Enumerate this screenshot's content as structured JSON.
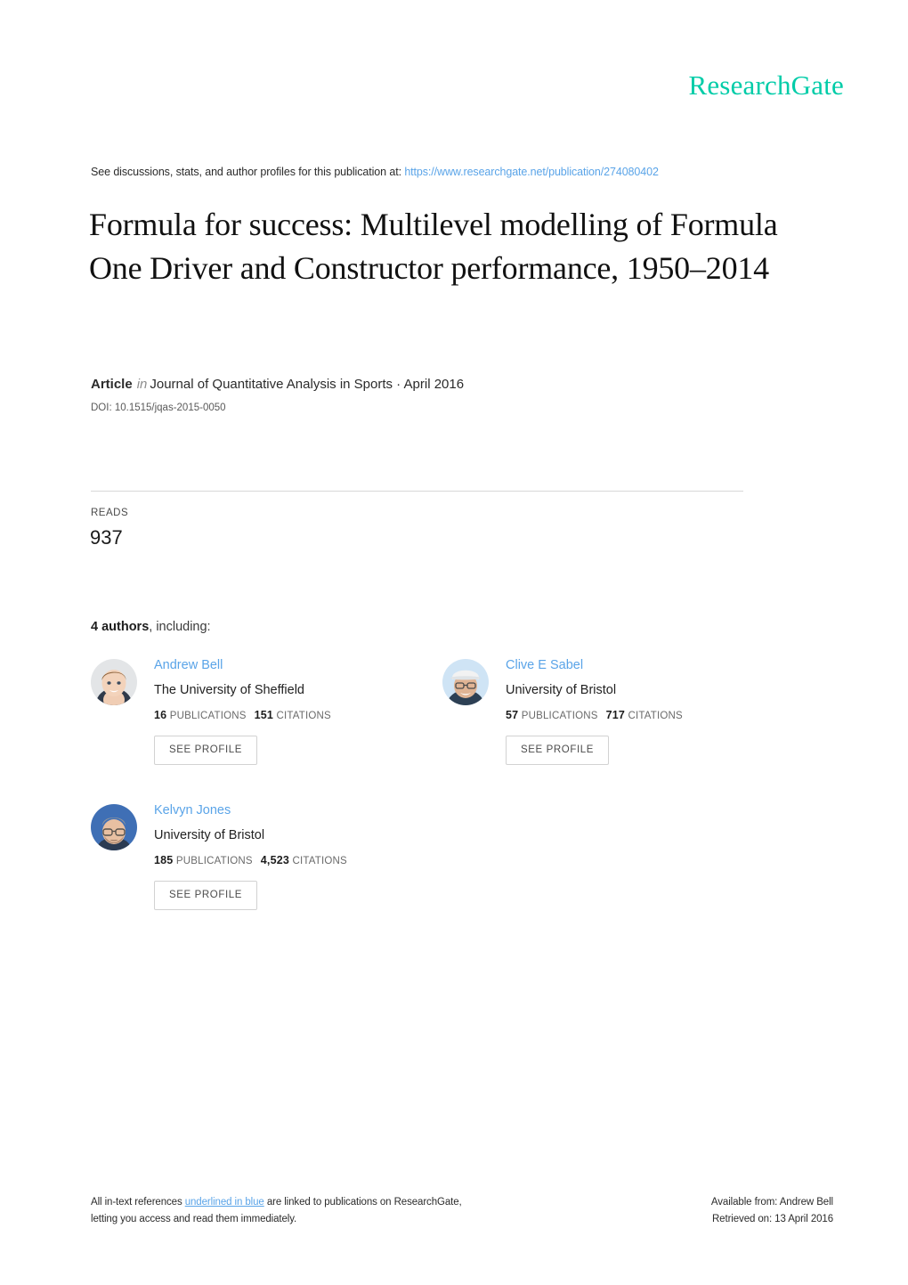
{
  "brand": {
    "name": "ResearchGate",
    "color": "#00cca8"
  },
  "discussions": {
    "prefix": "See discussions, stats, and author profiles for this publication at:",
    "url": "https://www.researchgate.net/publication/274080402"
  },
  "publication": {
    "title": "Formula for success: Multilevel modelling of Formula One Driver and Constructor performance, 1950–2014",
    "type": "Article",
    "connector": "in",
    "journal": "Journal of Quantitative Analysis in Sports · April 2016",
    "doi": "DOI: 10.1515/jqas-2015-0050"
  },
  "stats": {
    "reads_label": "READS",
    "reads_value": "937"
  },
  "authors_section": {
    "count_label": "4 authors",
    "including_label": ", including:",
    "see_profile_label": "SEE PROFILE",
    "publications_label": "PUBLICATIONS",
    "citations_label": "CITATIONS",
    "authors": [
      {
        "name": "Andrew Bell",
        "affiliation": "The University of Sheffield",
        "publications": "16",
        "citations": "151",
        "avatar": "avatar-andrew-bell"
      },
      {
        "name": "Clive E Sabel",
        "affiliation": "University of Bristol",
        "publications": "57",
        "citations": "717",
        "avatar": "avatar-clive-sabel"
      },
      {
        "name": "Kelvyn Jones",
        "affiliation": "University of Bristol",
        "publications": "185",
        "citations": "4,523",
        "avatar": "avatar-kelvyn-jones"
      }
    ]
  },
  "footer": {
    "left_line1_a": "All in-text references ",
    "left_line1_link": "underlined in blue",
    "left_line1_b": " are linked to publications on ResearchGate,",
    "left_line2": "letting you access and read them immediately.",
    "right_line1": "Available from: Andrew Bell",
    "right_line2": "Retrieved on: 13 April 2016"
  },
  "link_color": "#5aa4e8"
}
